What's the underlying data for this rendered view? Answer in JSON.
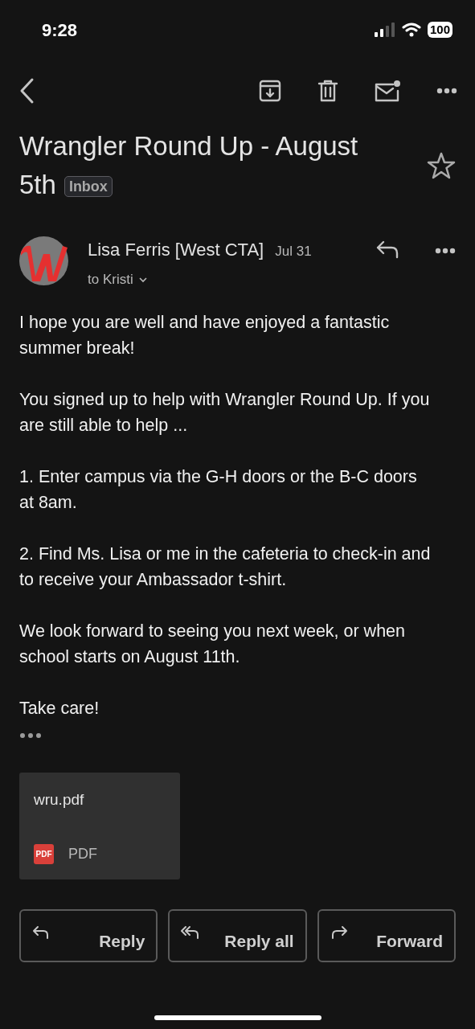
{
  "status_bar": {
    "time": "9:28",
    "battery": "100"
  },
  "email": {
    "subject_lines": [
      "Wrangler Round Up - August",
      "5th"
    ],
    "label": "Inbox",
    "starred": false,
    "sender": "Lisa Ferris [West CTA]",
    "date": "Jul 31",
    "recipient": "to Kristi",
    "body": [
      "I hope you are well and have enjoyed a fantastic summer break!",
      "You signed up to help with Wrangler Round Up.  If you are still able to help ...",
      "1. Enter campus via the G-H doors or the B-C doors at 8am.",
      "2. Find Ms. Lisa or me in the cafeteria to check-in and to receive your Ambassador t-shirt.",
      "We look forward to seeing you next week, or when school starts on August 11th.",
      "Take care!"
    ],
    "attachment": {
      "name": "wru.pdf",
      "badge": "PDF",
      "type": "PDF"
    }
  },
  "actions": [
    {
      "kind": "reply",
      "label": "Reply"
    },
    {
      "kind": "reply_all",
      "label": "Reply all"
    },
    {
      "kind": "forward",
      "label": "Forward"
    }
  ]
}
